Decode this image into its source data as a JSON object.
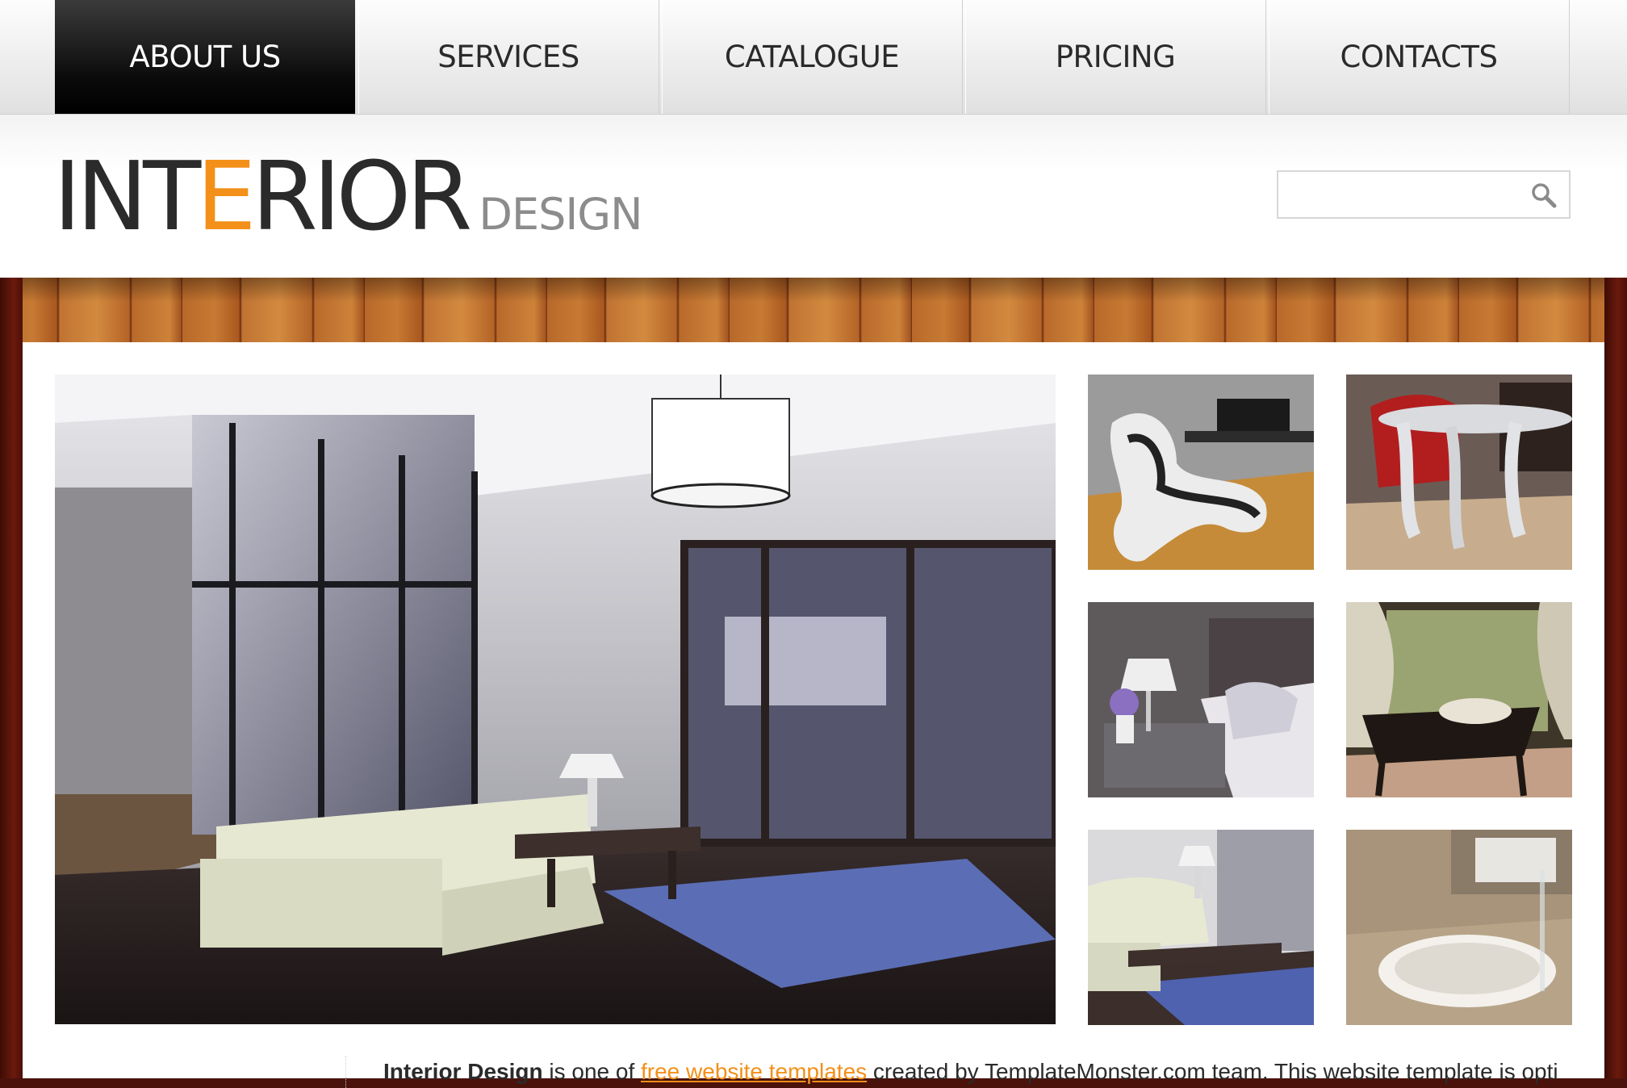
{
  "nav": {
    "items": [
      {
        "label": "ABOUT US",
        "active": true
      },
      {
        "label": "SERVICES",
        "active": false
      },
      {
        "label": "CATALOGUE",
        "active": false
      },
      {
        "label": "PRICING",
        "active": false
      },
      {
        "label": "CONTACTS",
        "active": false
      }
    ]
  },
  "logo": {
    "main_pre": "INT",
    "main_accent": "E",
    "main_post": "RIOR",
    "sub": "DESIGN"
  },
  "search": {
    "value": "",
    "icon": "search-icon"
  },
  "gallery": {
    "hero_icon": "living-room-photo",
    "thumbnails": [
      "armchair-photo",
      "dining-table-photo",
      "bedroom-photo",
      "rocking-chair-photo",
      "sofa-photo",
      "bathtub-photo"
    ]
  },
  "intro": {
    "bold": "Interior Design",
    "text1": " is one of ",
    "link": "free website templates",
    "text2": " created by TemplateMonster.com team. This website template is opti"
  },
  "colors": {
    "accent": "#f39019",
    "nav_active": "#000000",
    "text": "#2b2b2b",
    "wood": "#b8692a"
  }
}
